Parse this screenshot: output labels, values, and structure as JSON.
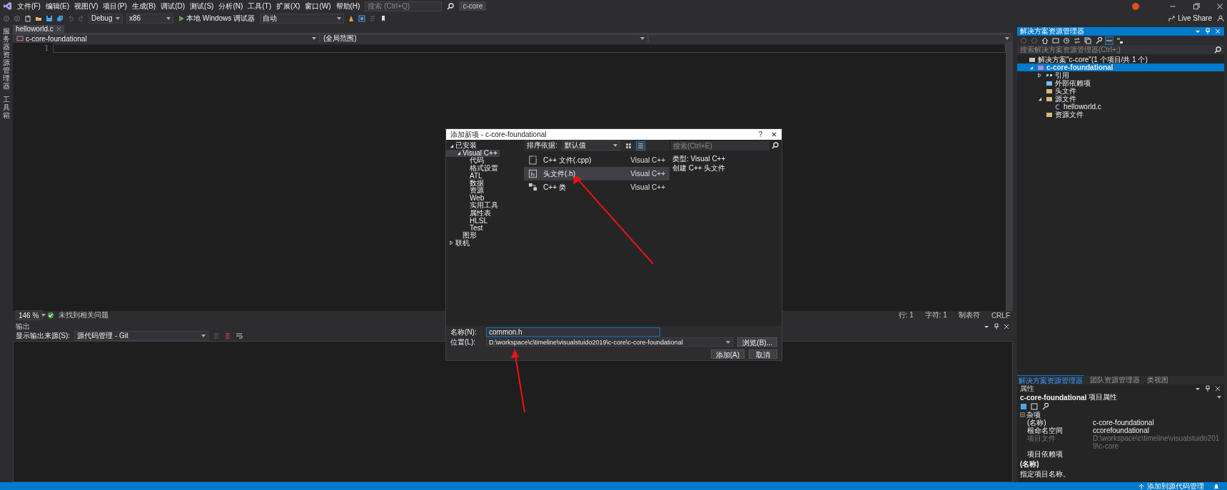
{
  "menu": [
    "文件(F)",
    "编辑(E)",
    "视图(V)",
    "项目(P)",
    "生成(B)",
    "调试(D)",
    "测试(S)",
    "分析(N)",
    "工具(T)",
    "扩展(X)",
    "窗口(W)",
    "帮助(H)"
  ],
  "search": {
    "placeholder": "搜索 (Ctrl+Q)"
  },
  "solution_name": "c-core",
  "toolbar": {
    "config": "Debug",
    "platform": "x86",
    "run_label": "本地 Windows 调试器",
    "run_mode": "自动",
    "live_share": "Live Share"
  },
  "left_strip": [
    "服务器资源管理器",
    "工具箱"
  ],
  "editor": {
    "tabs": [
      {
        "label": "helloworld.c",
        "selected": true
      }
    ],
    "nav_project": "c-core-foundational",
    "nav_scope": "(全局范围)",
    "line_numbers": [
      "1"
    ],
    "zoom": "146 %",
    "issues": "未找到相关问题",
    "position": [
      "行: 1",
      "字符: 1",
      "制表符",
      "CRLF"
    ]
  },
  "output": {
    "title": "输出",
    "source_label": "显示输出来源(S):",
    "source_value": "源代码管理 - Git"
  },
  "dialog": {
    "title": "添加新项 - c-core-foundational",
    "help": "?",
    "categories": [
      {
        "label": "已安装",
        "expanded": true,
        "selected": false,
        "children": [
          {
            "label": "Visual C++",
            "expanded": true,
            "selected": true,
            "children": [
              {
                "label": "代码",
                "selected": false
              },
              {
                "label": "格式设置",
                "selected": false
              },
              {
                "label": "ATL",
                "selected": false
              },
              {
                "label": "数据",
                "selected": false
              },
              {
                "label": "资源",
                "selected": false
              },
              {
                "label": "Web",
                "selected": false
              },
              {
                "label": "实用工具",
                "selected": false
              },
              {
                "label": "属性表",
                "selected": false
              },
              {
                "label": "HLSL",
                "selected": false
              },
              {
                "label": "Test",
                "selected": false
              }
            ]
          },
          {
            "label": "图形",
            "selected": false
          }
        ]
      },
      {
        "label": "联机",
        "expanded": false,
        "selected": false
      }
    ],
    "sort_label": "排序依据:",
    "sort_value": "默认值",
    "views": [
      {
        "kind": "grid",
        "selected": false
      },
      {
        "kind": "list",
        "selected": true
      }
    ],
    "templates": [
      {
        "kind": "cpp",
        "name": "C++ 文件(.cpp)",
        "type": "Visual C++",
        "selected": false
      },
      {
        "kind": "header",
        "name": "头文件(.h)",
        "type": "Visual C++",
        "selected": true
      },
      {
        "kind": "class",
        "name": "C++ 类",
        "type": "Visual C++",
        "selected": false
      }
    ],
    "search_placeholder": "搜索(Ctrl+E)",
    "details": [
      "类型: Visual C++",
      "创建 C++ 头文件"
    ],
    "name_label": "名称(N):",
    "name_value": "common.h",
    "location_label": "位置(L):",
    "location_value": "D:\\workspace\\c\\timeline\\visualstuido2019\\c-core\\c-core-foundational",
    "browse": "浏览(B)...",
    "add": "添加(A)",
    "cancel": "取消"
  },
  "solution_explorer": {
    "title": "解决方案资源管理器",
    "search_placeholder": "搜索解决方案资源管理器(Ctrl+;)",
    "tree": [
      {
        "kind": "solution",
        "label": "解决方案\"c-core\"(1 个项目/共 1 个)",
        "selected": false,
        "children": [
          {
            "kind": "project",
            "label": "c-core-foundational",
            "expanded": true,
            "selected": true,
            "children": [
              {
                "kind": "references",
                "label": "引用",
                "expanded": false,
                "selected": false
              },
              {
                "kind": "external",
                "label": "外部依赖项",
                "selected": false
              },
              {
                "kind": "filter",
                "label": "头文件",
                "selected": false
              },
              {
                "kind": "filter",
                "label": "源文件",
                "expanded": true,
                "selected": false,
                "children": [
                  {
                    "kind": "file",
                    "label": "helloworld.c",
                    "selected": false
                  }
                ]
              },
              {
                "kind": "filter",
                "label": "资源文件",
                "selected": false
              }
            ]
          }
        ]
      }
    ],
    "tabs": [
      {
        "label": "解决方案资源管理器",
        "selected": true
      },
      {
        "label": "团队资源管理器",
        "selected": false
      },
      {
        "label": "类视图",
        "selected": false
      }
    ]
  },
  "properties": {
    "title": "属性",
    "object": "c-core-foundational",
    "object_type": "项目属性",
    "category": "杂项",
    "rows": [
      {
        "name": "(名称)",
        "value": "c-core-foundational",
        "disabled": false
      },
      {
        "name": "根命名空间",
        "value": "ccorefoundational",
        "disabled": false
      },
      {
        "name": "项目文件",
        "value": "D:\\workspace\\c\\timeline\\visualstuido2019\\c-core",
        "disabled": true
      },
      {
        "name": "项目依赖项",
        "disabled": false
      }
    ],
    "description_title": "(名称)",
    "description": "指定项目名称。"
  },
  "status_bar": {
    "source_control": "添加到源代码管理"
  }
}
